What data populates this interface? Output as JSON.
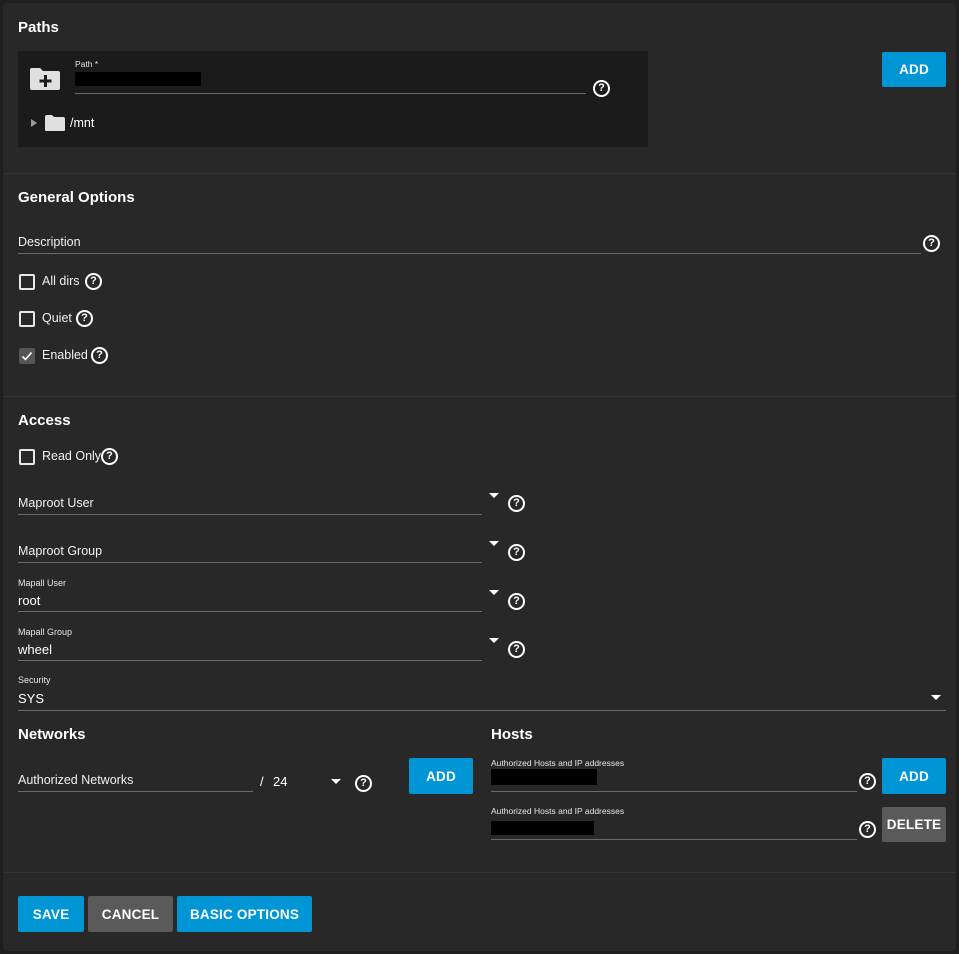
{
  "paths": {
    "title": "Paths",
    "path_label": "Path *",
    "path_value": "",
    "tree_root": "/mnt",
    "add_label": "ADD"
  },
  "general": {
    "title": "General Options",
    "description_placeholder": "Description",
    "description_value": "",
    "all_dirs_label": "All dirs",
    "all_dirs_checked": false,
    "quiet_label": "Quiet",
    "quiet_checked": false,
    "enabled_label": "Enabled",
    "enabled_checked": true
  },
  "access": {
    "title": "Access",
    "read_only_label": "Read Only",
    "read_only_checked": false,
    "maproot_user_placeholder": "Maproot User",
    "maproot_group_placeholder": "Maproot Group",
    "mapall_user_label": "Mapall User",
    "mapall_user_value": "root",
    "mapall_group_label": "Mapall Group",
    "mapall_group_value": "wheel",
    "security_label": "Security",
    "security_value": "SYS"
  },
  "networks": {
    "title": "Networks",
    "authorized_networks_placeholder": "Authorized Networks",
    "separator": "/",
    "mask": "24",
    "add_label": "ADD"
  },
  "hosts": {
    "title": "Hosts",
    "host1_label": "Authorized Hosts and IP addresses",
    "host1_value": "",
    "host2_label": "Authorized Hosts and IP addresses",
    "host2_value": "",
    "add_label": "ADD",
    "delete_label": "DELETE"
  },
  "footer": {
    "save_label": "SAVE",
    "cancel_label": "CANCEL",
    "basic_options_label": "BASIC OPTIONS"
  },
  "icons": {
    "help": "help-circle-icon",
    "folder_add": "folder-plus-icon",
    "folder": "folder-icon",
    "expand": "triangle-right-icon",
    "dropdown": "caret-down-icon",
    "check": "check-icon"
  },
  "colors": {
    "accent": "#0095d5",
    "secondary_button": "#5a5a5a",
    "card": "#282828",
    "background": "#1e1e1e"
  }
}
